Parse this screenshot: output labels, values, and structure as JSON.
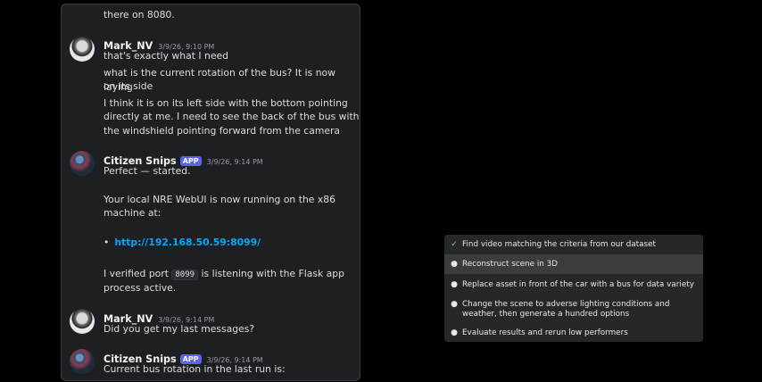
{
  "chat": {
    "top_fragment": "there on 8080.",
    "messages": [
      {
        "author": "Mark_NV",
        "time": "3/9/26, 9:10 PM",
        "lines": [
          "that's exactly what I need",
          "what is the current rotation of the bus? It is now laying",
          "on its side",
          "I think it is on its left side with the bottom pointing",
          "directly at me. I need to see the back of the bus with",
          "the windshield pointing forward from the camera"
        ]
      },
      {
        "author": "Citizen Snips",
        "badge": "APP",
        "time": "3/9/26, 9:14 PM",
        "lines": [
          "Perfect — started.",
          "Your local NRE WebUI is now running on the x86",
          "machine at:"
        ],
        "link": "http://192.168.50.59:8099/",
        "port_prefix": "I verified port",
        "port_code": "8099",
        "port_suffix": "is listening with the Flask app",
        "port_line2": "process active."
      },
      {
        "author": "Mark_NV",
        "time": "3/9/26, 9:14 PM",
        "lines": [
          "Did you get my last messages?"
        ]
      },
      {
        "author": "Citizen Snips",
        "badge": "APP",
        "time": "3/9/26, 9:14 PM",
        "lines": [
          "Current bus rotation in the last run is:"
        ]
      }
    ]
  },
  "tasks": {
    "items": [
      {
        "label": "Find video matching the criteria from our dataset",
        "status": "done",
        "icon": "check-icon"
      },
      {
        "label": "Reconstruct scene in 3D",
        "status": "active",
        "icon": "bullet-icon"
      },
      {
        "label": "Replace asset in front of the car with a bus for data variety",
        "status": "pending",
        "icon": "bullet-icon"
      },
      {
        "label_line1": "Change the scene to adverse lighting conditions and",
        "label_line2": "weather, then generate a hundred options",
        "status": "pending",
        "icon": "bullet-icon"
      },
      {
        "label": "Evaluate results and rerun low performers",
        "status": "pending",
        "icon": "bullet-icon"
      }
    ]
  },
  "colors": {
    "background": "#000000",
    "chat_bg": "#1e1f22",
    "app_badge": "#5865f2",
    "link": "#00a8fc",
    "task_panel": "#26272b",
    "task_active": "#3b3c40",
    "check": "#8fd14f"
  }
}
